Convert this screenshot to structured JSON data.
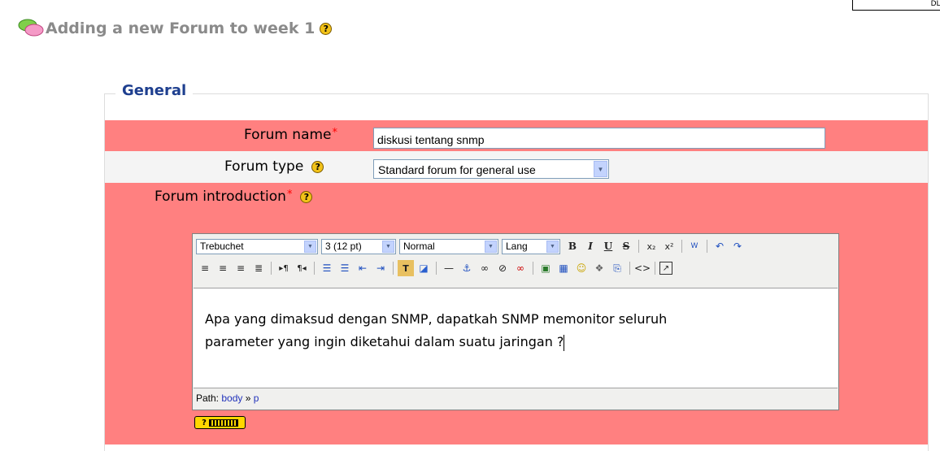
{
  "corner_text": "DL: U",
  "title": "Adding a new Forum to week 1",
  "legend": "General",
  "fields": {
    "forum_name": {
      "label": "Forum name",
      "value": "diskusi tentang snmp"
    },
    "forum_type": {
      "label": "Forum type",
      "value": "Standard forum for general use"
    },
    "forum_intro": {
      "label": "Forum introduction"
    }
  },
  "required_mark": "*",
  "help_glyph": "?",
  "editor": {
    "font_family": "Trebuchet",
    "font_size": "3 (12 pt)",
    "format": "Normal",
    "lang": "Lang",
    "content_line1": "Apa yang dimaksud dengan SNMP, dapatkah SNMP memonitor seluruh",
    "content_line2": "parameter yang ingin diketahui dalam suatu jaringan ?",
    "path_label": "Path:",
    "path_body": "body",
    "path_sep": "»",
    "path_p": "p"
  },
  "colors": {
    "error_row": "#ff8080",
    "legend": "#1e3f8f",
    "title": "#8a8a8a"
  },
  "icons": {
    "toolbar_row1": [
      "bold-icon",
      "italic-icon",
      "underline-icon",
      "strikethrough-icon",
      "subscript-icon",
      "superscript-icon",
      "paste-word-icon",
      "undo-icon",
      "redo-icon"
    ],
    "toolbar_row2": [
      "align-left-icon",
      "align-center-icon",
      "align-right-icon",
      "justify-icon",
      "ltr-icon",
      "rtl-icon",
      "ordered-list-icon",
      "unordered-list-icon",
      "outdent-icon",
      "indent-icon",
      "text-color-icon",
      "background-color-icon",
      "horizontal-rule-icon",
      "anchor-icon",
      "link-icon",
      "unlink-icon",
      "nolink-icon",
      "image-icon",
      "table-icon",
      "smiley-icon",
      "insert-char-icon",
      "search-replace-icon",
      "html-source-icon",
      "fullscreen-icon"
    ]
  }
}
